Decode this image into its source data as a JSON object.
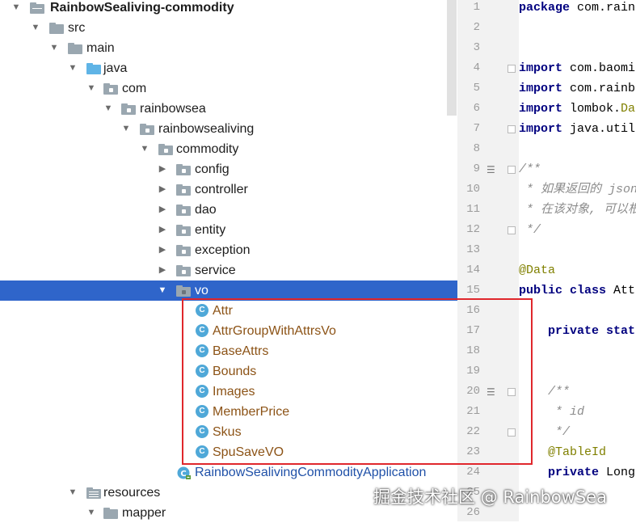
{
  "tree": {
    "project": "RainbowSealiving-commodity",
    "src": "src",
    "main": "main",
    "java": "java",
    "com": "com",
    "rainbowsea": "rainbowsea",
    "rainbowsealiving": "rainbowsealiving",
    "commodity": "commodity",
    "packages": [
      "config",
      "controller",
      "dao",
      "entity",
      "exception",
      "service"
    ],
    "vo": "vo",
    "vo_classes": [
      "Attr",
      "AttrGroupWithAttrsVo",
      "BaseAttrs",
      "Bounds",
      "Images",
      "MemberPrice",
      "Skus",
      "SpuSaveVO"
    ],
    "application": "RainbowSealivingCommodityApplication",
    "resources": "resources",
    "mapper": "mapper"
  },
  "editor": {
    "line_numbers": [
      "1",
      "2",
      "3",
      "4",
      "5",
      "6",
      "7",
      "8",
      "9",
      "10",
      "11",
      "12",
      "13",
      "14",
      "15",
      "16",
      "17",
      "18",
      "19",
      "20",
      "21",
      "22",
      "23",
      "24",
      "25",
      "26"
    ],
    "lines": {
      "l1_kw": "package",
      "l1_rest": " com.rain",
      "l4_kw": "import",
      "l4_rest": " com.baomi",
      "l5_kw": "import",
      "l5_rest": " com.rainb",
      "l6_kw": "import",
      "l6_rest": " lombok.",
      "l6_ann": "Da",
      "l7_kw": "import",
      "l7_rest": " java.util",
      "l9": "/**",
      "l10": " * 如果返回的 json",
      "l11": " * 在该对象, 可以根",
      "l12": " */",
      "l14": "@Data",
      "l15_kw": "public class",
      "l15_rest": " Att",
      "l17_kw": "    private stat",
      "l20": "    /**",
      "l21": "     * id",
      "l22": "     */",
      "l23": "    @TableId",
      "l24_kw": "    private",
      "l24_rest": " Long"
    }
  },
  "watermark": "掘金技术社区 @ RainbowSea"
}
